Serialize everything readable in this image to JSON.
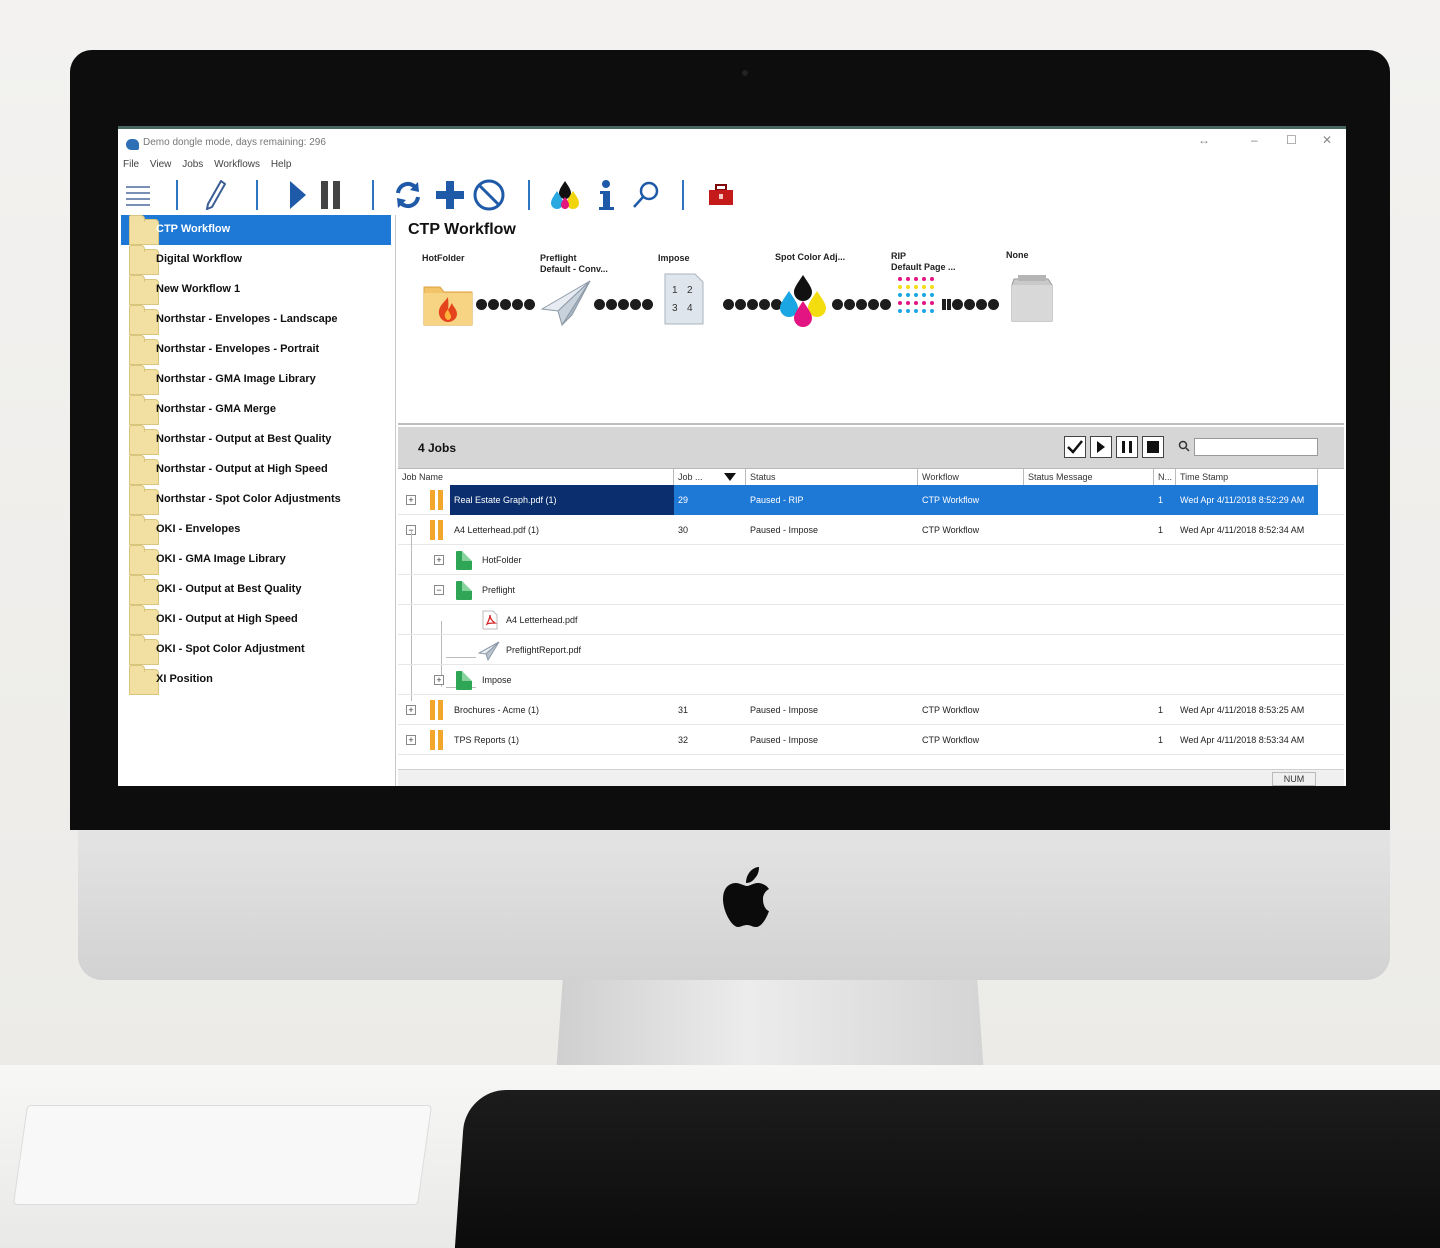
{
  "window": {
    "title": "Demo dongle mode, days remaining: 296",
    "controls": [
      "↔",
      "–",
      "☐",
      "✕"
    ]
  },
  "menu": [
    "File",
    "View",
    "Jobs",
    "Workflows",
    "Help"
  ],
  "toolbar": {
    "icons": [
      "menu-icon",
      "edit-pencil-icon",
      "play-icon",
      "pause-icon",
      "refresh-icon",
      "add-icon",
      "cancel-icon",
      "ink-drops-icon",
      "info-icon",
      "search-icon",
      "toolbox-icon"
    ]
  },
  "workflows": {
    "selected": "CTP Workflow",
    "items": [
      "CTP Workflow",
      "Digital Workflow",
      "New Workflow 1",
      "Northstar - Envelopes - Landscape",
      "Northstar - Envelopes - Portrait",
      "Northstar - GMA Image Library",
      "Northstar - GMA Merge",
      "Northstar - Output at Best Quality",
      "Northstar - Output at High Speed",
      "Northstar - Spot Color Adjustments",
      "OKI - Envelopes",
      "OKI - GMA Image Library",
      "OKI - Output at Best Quality",
      "OKI - Output at High Speed",
      "OKI - Spot Color Adjustment",
      "XI Position"
    ]
  },
  "workflow_panel": {
    "title": "CTP Workflow",
    "steps": [
      {
        "label": "HotFolder",
        "sub": "",
        "icon": "hotfolder-icon"
      },
      {
        "label": "Preflight",
        "sub": "Default - Conv...",
        "icon": "paper-plane-icon"
      },
      {
        "label": "Impose",
        "sub": "",
        "icon": "impose-icon",
        "pages": [
          "1",
          "2",
          "3",
          "4"
        ]
      },
      {
        "label": "Spot Color Adj...",
        "sub": "",
        "icon": "cmyk-drops-icon"
      },
      {
        "label": "RIP",
        "sub": "Default Page ...",
        "icon": "halftone-dots-icon"
      },
      {
        "label": "None",
        "sub": "",
        "icon": "output-device-icon"
      }
    ]
  },
  "jobs": {
    "count_label": "4 Jobs",
    "columns": [
      "Job Name",
      "Job ...",
      "Status",
      "Workflow",
      "Status Message",
      "N...",
      "Time Stamp"
    ],
    "rows": [
      {
        "name": "Real Estate Graph.pdf (1)",
        "job": "29",
        "status": "Paused - RIP",
        "workflow": "CTP Workflow",
        "message": "",
        "n": "1",
        "time": "Wed Apr 4/11/2018 8:52:29 AM",
        "expander": "+",
        "selected": true
      },
      {
        "name": "A4 Letterhead.pdf (1)",
        "job": "30",
        "status": "Paused - Impose",
        "workflow": "CTP Workflow",
        "message": "",
        "n": "1",
        "time": "Wed Apr 4/11/2018 8:52:34 AM",
        "expander": "−"
      },
      {
        "name": "HotFolder",
        "expander": "+",
        "child": 1
      },
      {
        "name": "Preflight",
        "expander": "−",
        "child": 1
      },
      {
        "name": "A4 Letterhead.pdf",
        "child": 2,
        "icon": "pdf-icon"
      },
      {
        "name": "PreflightReport.pdf",
        "child": 2,
        "icon": "paper-plane-icon"
      },
      {
        "name": "Impose",
        "expander": "+",
        "child": 1
      },
      {
        "name": "Brochures - Acme (1)",
        "job": "31",
        "status": "Paused - Impose",
        "workflow": "CTP Workflow",
        "message": "",
        "n": "1",
        "time": "Wed Apr 4/11/2018 8:53:25 AM",
        "expander": "+"
      },
      {
        "name": "TPS Reports (1)",
        "job": "32",
        "status": "Paused - Impose",
        "workflow": "CTP Workflow",
        "message": "",
        "n": "1",
        "time": "Wed Apr 4/11/2018 8:53:34 AM",
        "expander": "+"
      }
    ]
  },
  "statusbar": {
    "num": "NUM"
  },
  "colors": {
    "accent": "#1e78d6",
    "selected_name": "#0b2f6e",
    "pause": "#f2a62b",
    "folder": "#f1e0a2"
  }
}
